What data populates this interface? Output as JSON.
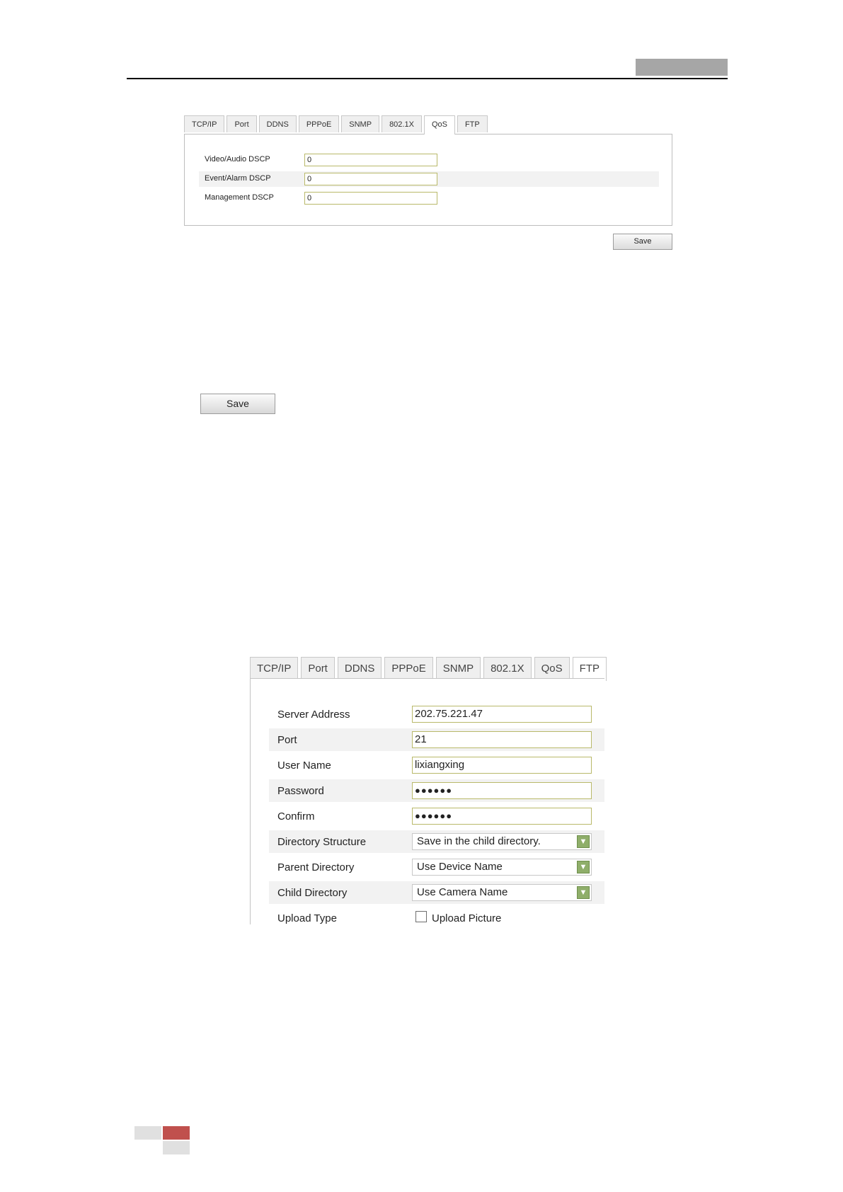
{
  "qos_screenshot": {
    "tabs": [
      "TCP/IP",
      "Port",
      "DDNS",
      "PPPoE",
      "SNMP",
      "802.1X",
      "QoS",
      "FTP"
    ],
    "active_tab": "QoS",
    "fields": [
      {
        "label": "Video/Audio DSCP",
        "value": "0"
      },
      {
        "label": "Event/Alarm DSCP",
        "value": "0"
      },
      {
        "label": "Management DSCP",
        "value": "0"
      }
    ],
    "save_label": "Save"
  },
  "standalone_save_label": "Save",
  "ftp_screenshot": {
    "tabs": [
      "TCP/IP",
      "Port",
      "DDNS",
      "PPPoE",
      "SNMP",
      "802.1X",
      "QoS",
      "FTP"
    ],
    "active_tab": "FTP",
    "fields": [
      {
        "label": "Server Address",
        "value": "202.75.221.47",
        "type": "text"
      },
      {
        "label": "Port",
        "value": "21",
        "type": "text"
      },
      {
        "label": "User Name",
        "value": "lixiangxing",
        "type": "text"
      },
      {
        "label": "Password",
        "value": "●●●●●●",
        "type": "password"
      },
      {
        "label": "Confirm",
        "value": "●●●●●●",
        "type": "password"
      },
      {
        "label": "Directory Structure",
        "value": "Save in the child directory.",
        "type": "select"
      },
      {
        "label": "Parent Directory",
        "value": "Use Device Name",
        "type": "select"
      },
      {
        "label": "Child Directory",
        "value": "Use Camera Name",
        "type": "select"
      },
      {
        "label": "Upload Type",
        "value": "Upload Picture",
        "type": "checkbox",
        "checked": false
      }
    ]
  }
}
